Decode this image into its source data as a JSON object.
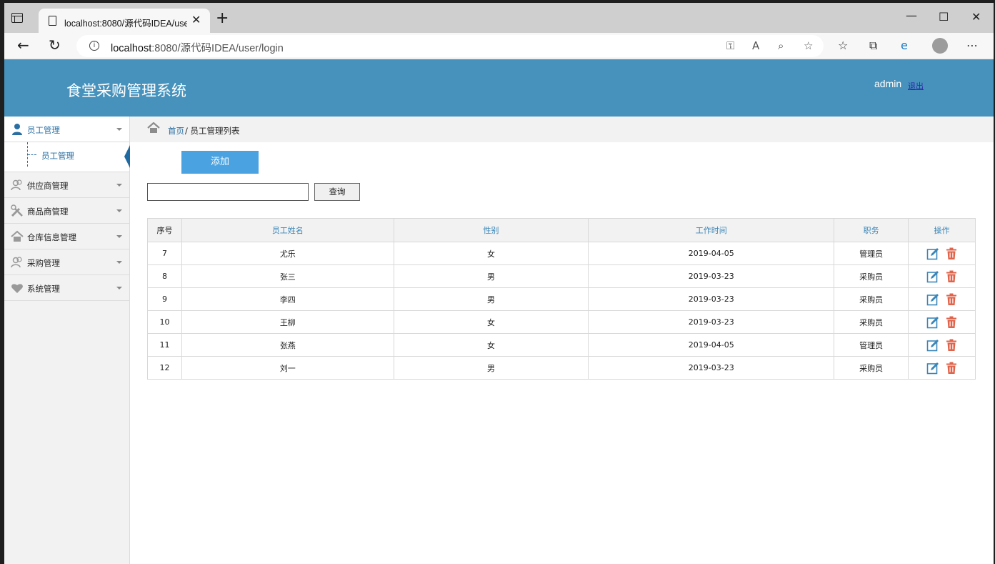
{
  "browser": {
    "tab_title": "localhost:8080/源代码IDEA/user/",
    "url_host": "localhost",
    "url_rest": ":8080/源代码IDEA/user/login"
  },
  "app": {
    "title": "食堂采购管理系统",
    "user": "admin",
    "logout": "退出",
    "accent": "#4692bc"
  },
  "sidebar": {
    "items": [
      {
        "label": "员工管理",
        "icon": "person-icon",
        "active": true
      },
      {
        "label": "供应商管理",
        "icon": "users-icon"
      },
      {
        "label": "商品商管理",
        "icon": "tools-icon"
      },
      {
        "label": "仓库信息管理",
        "icon": "home-icon"
      },
      {
        "label": "采购管理",
        "icon": "users-icon"
      },
      {
        "label": "系统管理",
        "icon": "heart-icon"
      }
    ],
    "sub_item": "员工管理"
  },
  "breadcrumb": {
    "home": "首页",
    "current": "/ 员工管理列表"
  },
  "actions": {
    "add": "添加",
    "search": "查询",
    "search_value": ""
  },
  "table": {
    "headers": [
      "序号",
      "员工姓名",
      "性别",
      "工作时间",
      "职务",
      "操作"
    ],
    "rows": [
      [
        "7",
        "尤乐",
        "女",
        "2019-04-05",
        "管理员"
      ],
      [
        "8",
        "张三",
        "男",
        "2019-03-23",
        "采购员"
      ],
      [
        "9",
        "李四",
        "男",
        "2019-03-23",
        "采购员"
      ],
      [
        "10",
        "王柳",
        "女",
        "2019-03-23",
        "采购员"
      ],
      [
        "11",
        "张燕",
        "女",
        "2019-04-05",
        "管理员"
      ],
      [
        "12",
        "刘一",
        "男",
        "2019-03-23",
        "采购员"
      ]
    ]
  }
}
